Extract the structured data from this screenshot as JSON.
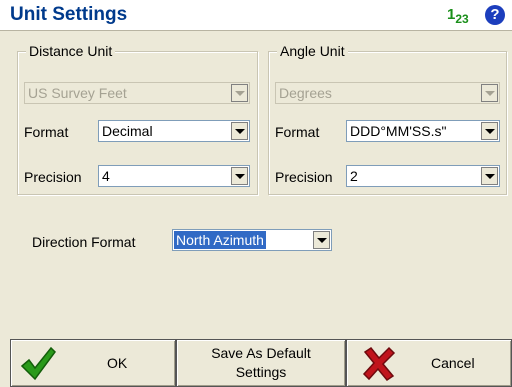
{
  "window": {
    "title": "Unit Settings",
    "input_mode": "1",
    "input_mode_sub": "23"
  },
  "distance_unit": {
    "legend": "Distance Unit",
    "unit_value": "US Survey Feet",
    "format_label": "Format",
    "format_value": "Decimal",
    "precision_label": "Precision",
    "precision_value": "4"
  },
  "angle_unit": {
    "legend": "Angle Unit",
    "unit_value": "Degrees",
    "format_label": "Format",
    "format_value": "DDD°MM'SS.s\"",
    "precision_label": "Precision",
    "precision_value": "2"
  },
  "direction": {
    "label": "Direction Format",
    "value": "North Azimuth"
  },
  "buttons": {
    "ok": "OK",
    "save_default_line1": "Save As Default",
    "save_default_line2": "Settings",
    "cancel": "Cancel"
  },
  "icons": [
    "help-icon",
    "checkmark-icon",
    "x-icon"
  ],
  "colors": {
    "title": "#003a8c",
    "selection": "#316ac5",
    "ok_green": "#2a9a1a",
    "cancel_red": "#c0141c"
  }
}
